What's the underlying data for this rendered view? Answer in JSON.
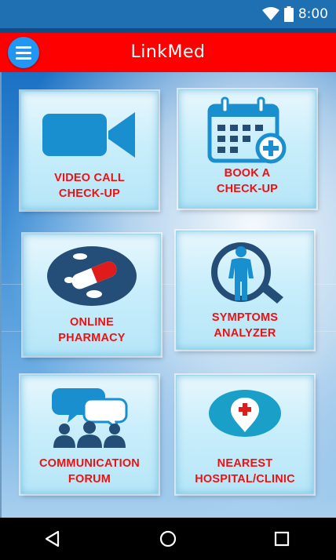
{
  "status_bar": {
    "time": "8:00",
    "wifi_icon": "wifi-icon",
    "battery_icon": "battery-icon"
  },
  "app_bar": {
    "title": "LinkMed",
    "menu_icon": "hamburger-menu-icon",
    "color": "#ff0000"
  },
  "tiles": [
    {
      "label_line1": "VIDEO CALL",
      "label_line2": "CHECK-UP",
      "icon": "video-camera-icon"
    },
    {
      "label_line1": "BOOK A",
      "label_line2": "CHECK-UP",
      "icon": "calendar-add-icon"
    },
    {
      "label_line1": "ONLINE",
      "label_line2": "PHARMACY",
      "icon": "pills-icon"
    },
    {
      "label_line1": "SYMPTOMS",
      "label_line2": "ANALYZER",
      "icon": "body-scan-icon"
    },
    {
      "label_line1": "COMMUNICATION",
      "label_line2": "FORUM",
      "icon": "group-chat-icon"
    },
    {
      "label_line1": "NEAREST",
      "label_line2": "HOSPITAL/CLINIC",
      "icon": "hospital-location-icon"
    }
  ],
  "nav_bar": {
    "back_icon": "back-triangle-icon",
    "home_icon": "home-circle-icon",
    "recents_icon": "recents-square-icon"
  },
  "colors": {
    "label": "#ee1111",
    "icon_blue": "#1a8fd0",
    "icon_dark": "#244e77",
    "status_bar": "#1f6fb3"
  }
}
